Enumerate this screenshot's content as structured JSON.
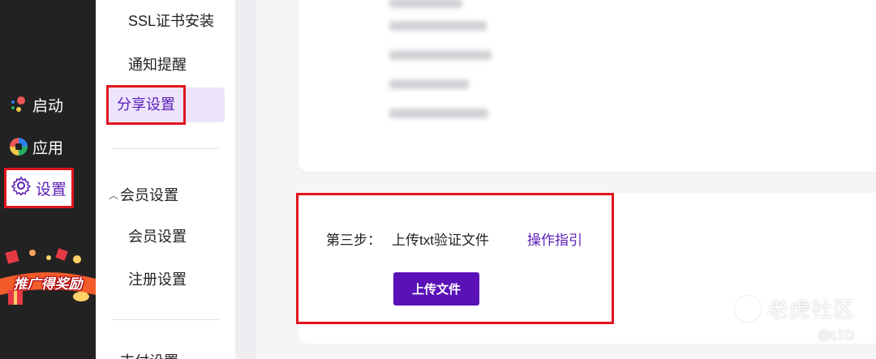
{
  "rail": {
    "items": [
      {
        "label": "启动",
        "icon": "launch-icon"
      },
      {
        "label": "应用",
        "icon": "apps-icon"
      },
      {
        "label": "设置",
        "icon": "gear-icon"
      }
    ],
    "promo": "推广得奖励"
  },
  "menu": {
    "items": [
      "SSL证书安装",
      "通知提醒",
      "分享设置"
    ],
    "active": "分享设置",
    "group": {
      "title": "会员设置",
      "items": [
        "会员设置",
        "注册设置"
      ]
    },
    "next_group_partial": "支付设置"
  },
  "step": {
    "label": "第三步：",
    "text": "上传txt验证文件",
    "guide_link": "操作指引",
    "upload_button": "上传文件"
  },
  "watermark": {
    "title": "老虎社区",
    "sub": "@LTD"
  },
  "colors": {
    "accent": "#5c1fb8",
    "highlight": "#e0141e",
    "rail_bg": "#222222"
  }
}
